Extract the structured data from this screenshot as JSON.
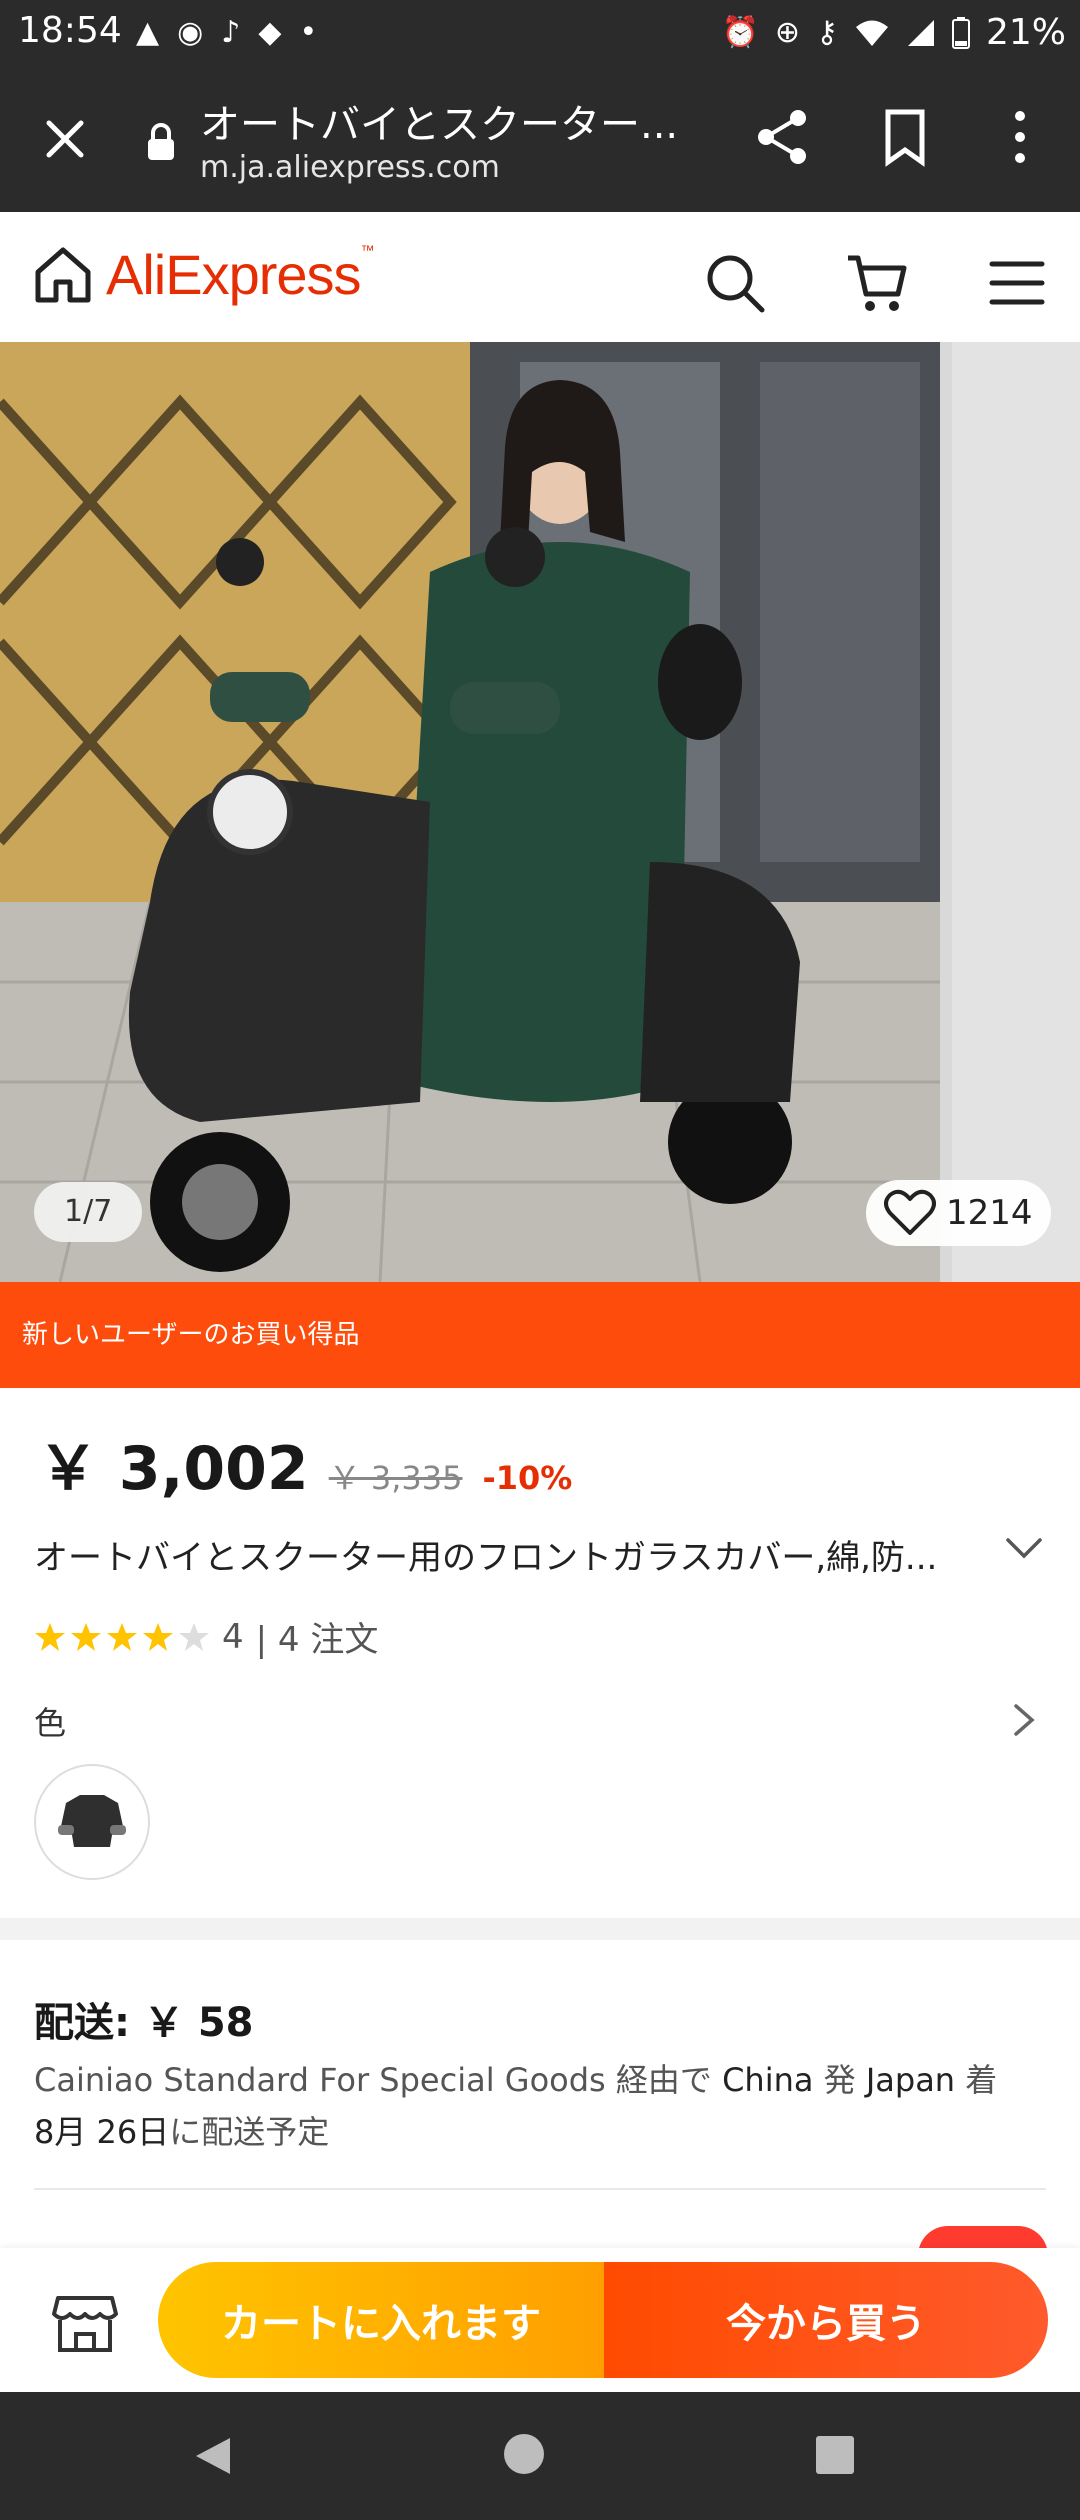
{
  "status_bar": {
    "time": "18:54",
    "battery": "21%",
    "left_icons": [
      "warning-icon",
      "app-icon",
      "tiktok-icon",
      "app-icon",
      "dot-icon"
    ],
    "right_icons": [
      "alarm-icon",
      "data-saver-icon",
      "vpn-key-icon",
      "wifi-icon",
      "signal-icon",
      "battery-icon"
    ]
  },
  "browser": {
    "page_title": "オートバイとスクーター...",
    "domain": "m.ja.aliexpress.com"
  },
  "header": {
    "logo": "AliExpress"
  },
  "gallery": {
    "counter": "1/7",
    "likes": "1214"
  },
  "promo": {
    "text": "新しいユーザーのお買い得品"
  },
  "product": {
    "price": "￥ 3,002",
    "original_price": "￥ 3,335",
    "discount": "-10%",
    "title": "オートバイとスクーター用のフロントガラスカバー,綿,防...",
    "rating": "4",
    "orders": "| 4 注文",
    "stars_filled": 4,
    "stars_total": 5,
    "color_label": "色"
  },
  "shipping": {
    "title": "配送: ￥ 58",
    "desc_carrier": "Cainiao Standard For Special Goods",
    "desc_via": " 経由で ",
    "desc_from": "China",
    "desc_from_suffix": " 発 ",
    "desc_to": "Japan",
    "desc_to_suffix": " 着",
    "desc_date_prefix": "",
    "desc_date": "8月 26日",
    "desc_date_suffix": "に配送予定"
  },
  "actions": {
    "add_to_cart": "カートに入れます",
    "buy_now": "今から買う"
  },
  "colors": {
    "brand": "#e62e04",
    "promo": "#fd4c0c",
    "cart_button": "#ffb300",
    "buy_button": "#ff4b00",
    "star": "#ffc300"
  }
}
